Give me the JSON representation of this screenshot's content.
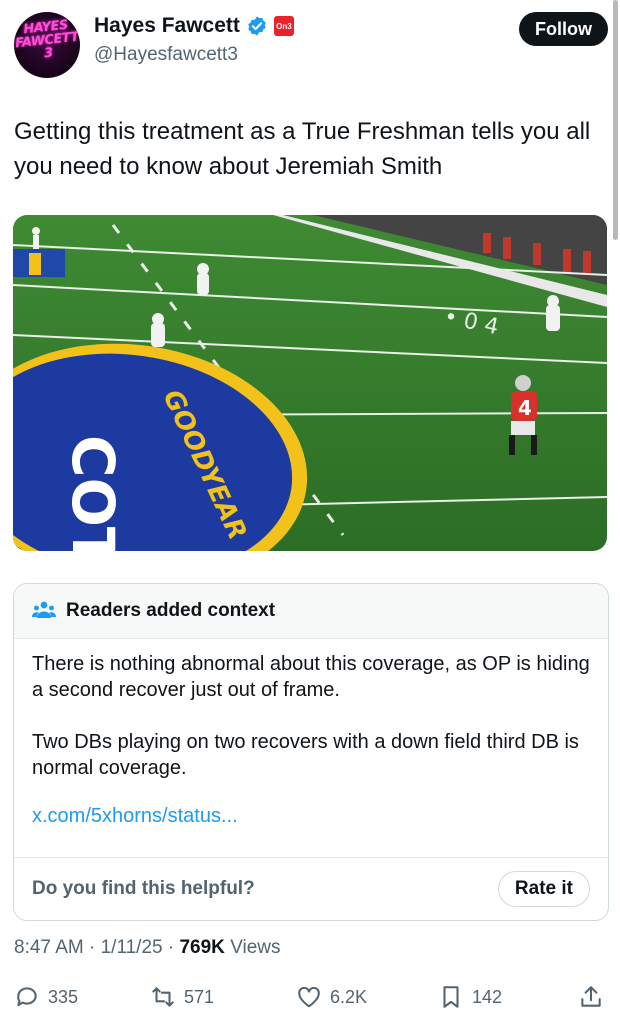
{
  "author": {
    "avatar_text": "HAYES FAWCETT 3",
    "display_name": "Hayes Fawcett",
    "handle": "@Hayesfawcett3",
    "org_badge": "On3"
  },
  "follow_label": "Follow",
  "tweet_text": "Getting this treatment as a True Freshman tells you all you need to know about Jeremiah Smith",
  "media": {
    "field_logo_text": "COTTON BOWL",
    "sponsor_text": "GOODYEAR",
    "jersey_number": "4"
  },
  "community_note": {
    "title": "Readers added context",
    "paragraphs": [
      "There is nothing abnormal about this coverage, as OP is hiding a second recover just out of frame.",
      "Two DBs playing on two recovers with a down field third DB is normal coverage."
    ],
    "link": "x.com/5xhorns/status...",
    "question": "Do you find this helpful?",
    "rate_label": "Rate it"
  },
  "meta": {
    "time": "8:47 AM",
    "date": "1/11/25",
    "views_count": "769K",
    "views_label": "Views"
  },
  "actions": {
    "replies": "335",
    "reposts": "571",
    "likes": "6.2K",
    "bookmarks": "142"
  },
  "colors": {
    "accent": "#1d9bf0",
    "verified": "#1d9bf0",
    "field_green": "#2f7a2a",
    "follow_bg": "#0f1419"
  }
}
